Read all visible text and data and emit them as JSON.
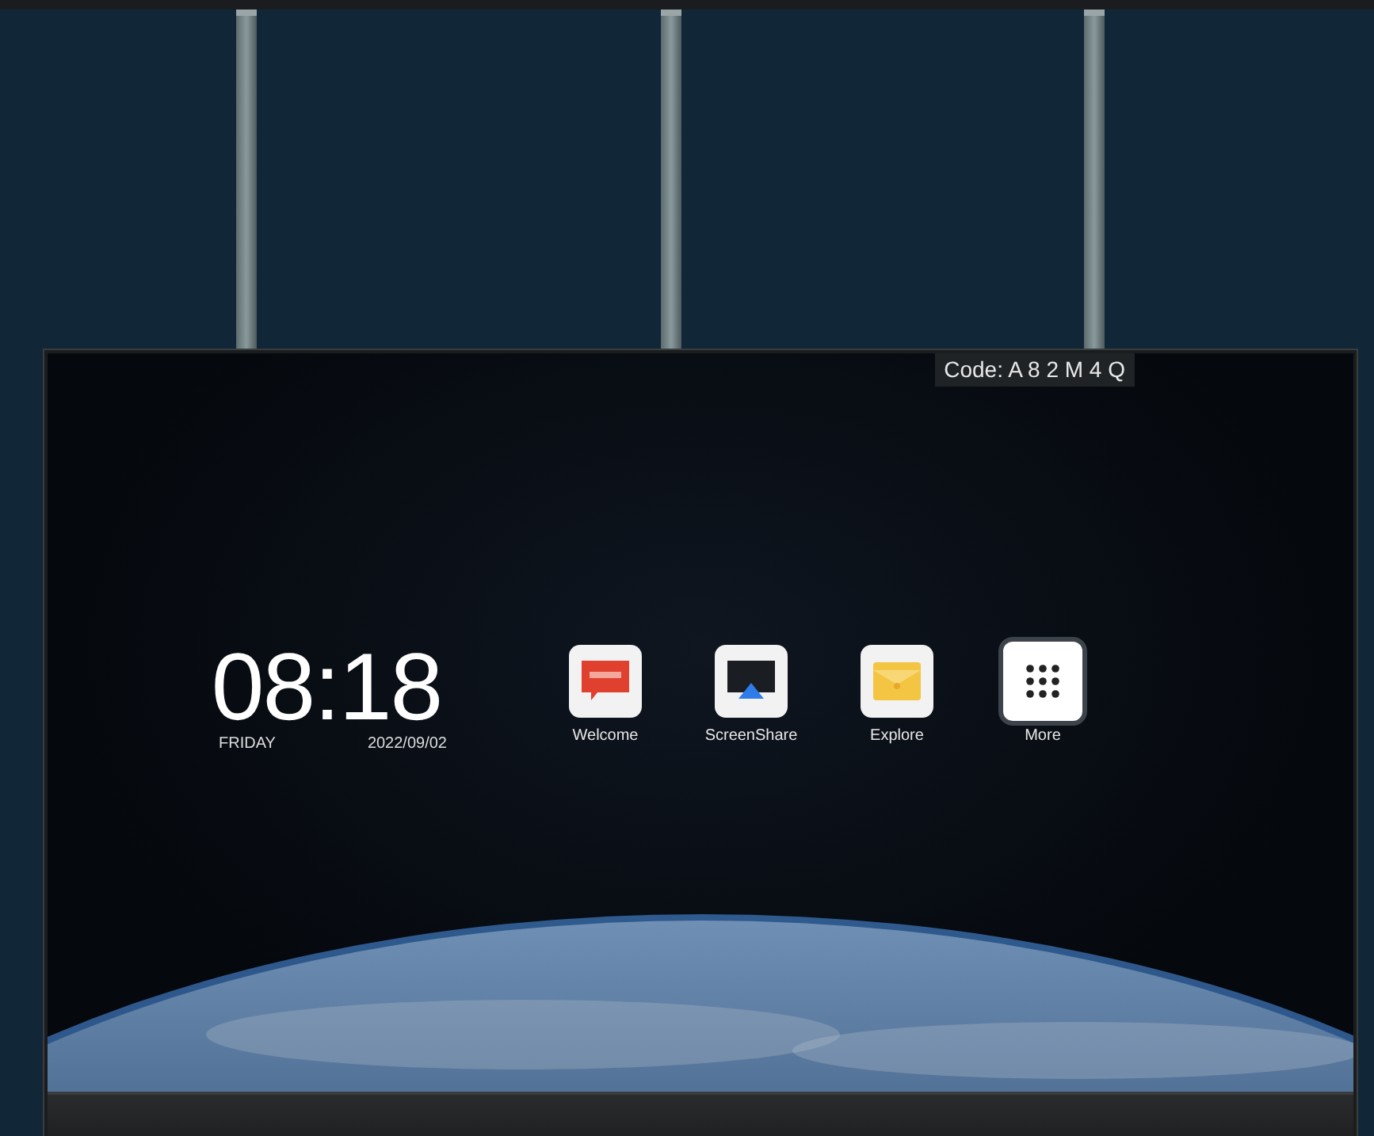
{
  "connection": {
    "code": "Code: A 8 2 M 4 Q"
  },
  "clock": {
    "time": "08:18",
    "day": "FRIDAY",
    "date": "2022/09/02"
  },
  "apps": [
    {
      "kind": "welcome",
      "label": "Welcome",
      "selected": false
    },
    {
      "kind": "screenshare",
      "label": "ScreenShare",
      "selected": false
    },
    {
      "kind": "explore",
      "label": "Explore",
      "selected": false
    },
    {
      "kind": "more",
      "label": "More",
      "selected": true
    }
  ]
}
